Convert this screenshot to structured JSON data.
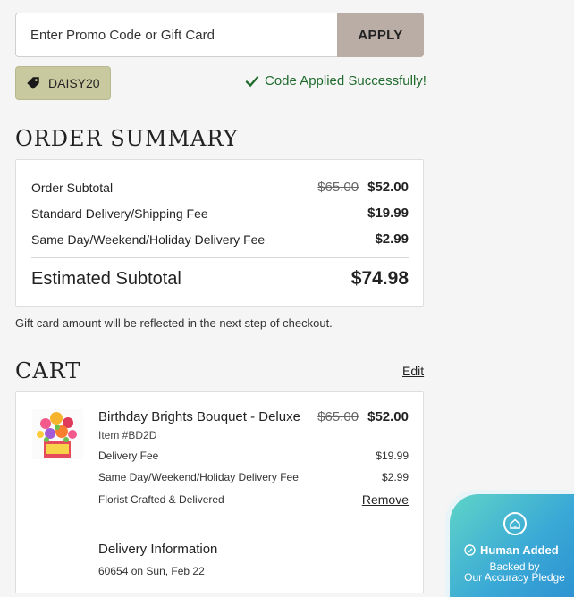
{
  "promo": {
    "placeholder": "Enter Promo Code or Gift Card",
    "apply_label": "APPLY",
    "applied_code": "DAISY20",
    "success_message": "Code Applied Successfully!",
    "success_color": "#1f6b2d"
  },
  "order_summary": {
    "title": "ORDER SUMMARY",
    "rows": [
      {
        "label": "Order Subtotal",
        "original": "$65.00",
        "value": "$52.00"
      },
      {
        "label": "Standard Delivery/Shipping Fee",
        "value": "$19.99"
      },
      {
        "label": "Same Day/Weekend/Holiday Delivery Fee",
        "value": "$2.99"
      }
    ],
    "estimated_label": "Estimated Subtotal",
    "estimated_value": "$74.98",
    "gift_note": "Gift card amount will be reflected in the next step of checkout."
  },
  "cart": {
    "title": "CART",
    "edit_label": "Edit",
    "item": {
      "name": "Birthday Brights Bouquet - Deluxe",
      "original_price": "$65.00",
      "price": "$52.00",
      "item_number": "Item #BD2D",
      "delivery_fee_label": "Delivery Fee",
      "delivery_fee": "$19.99",
      "sameday_label": "Same Day/Weekend/Holiday Delivery Fee",
      "sameday_fee": "$2.99",
      "florist_label": "Florist Crafted & Delivered",
      "remove_label": "Remove",
      "delivery_info_title": "Delivery Information",
      "delivery_info": "60654 on Sun, Feb 22"
    }
  },
  "badge": {
    "title": "Human Added",
    "line1": "Backed by",
    "line2": "Our Accuracy Pledge"
  },
  "icons": [
    "tag-icon",
    "checkmark-icon",
    "home-icon",
    "check-circle-icon"
  ],
  "colors": {
    "apply_button": "#b9ada5",
    "code_chip": "#c9c9a0",
    "badge_gradient": "#3aa8d6"
  }
}
